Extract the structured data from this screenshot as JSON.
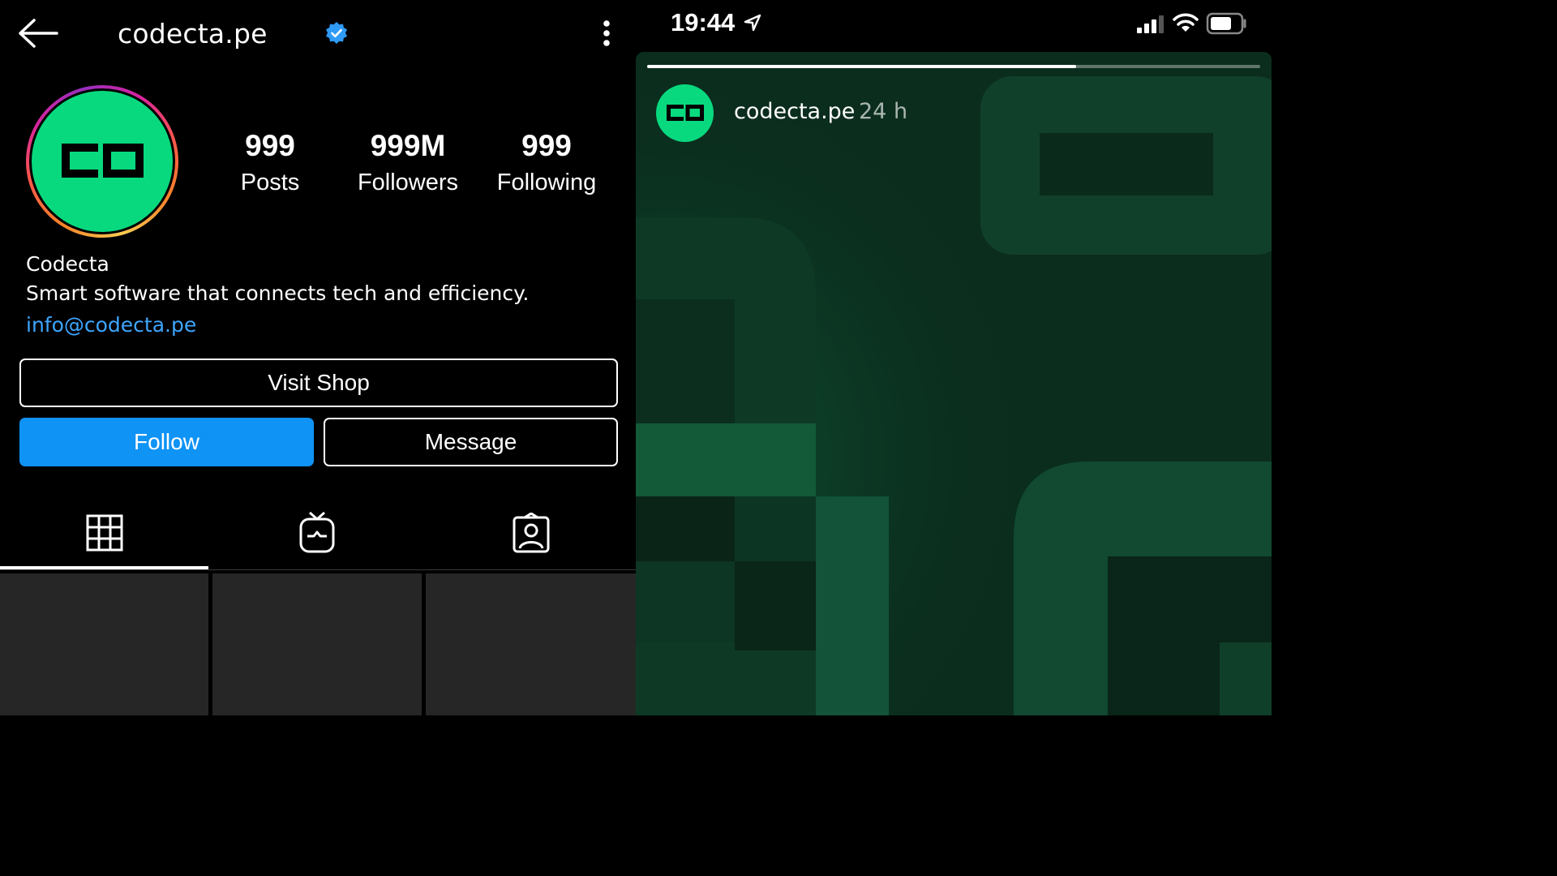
{
  "profile": {
    "header": {
      "username": "codecta.pe"
    },
    "stats": [
      {
        "value": "999",
        "label": "Posts"
      },
      {
        "value": "999M",
        "label": "Followers"
      },
      {
        "value": "999",
        "label": "Following"
      }
    ],
    "bio": {
      "name": "Codecta",
      "text": "Smart software that connects tech and efficiency.",
      "email": "info@codecta.pe"
    },
    "buttons": {
      "shop": "Visit Shop",
      "follow": "Follow",
      "message": "Message"
    },
    "tabs": [
      "posts-grid-icon",
      "igtv-icon",
      "tagged-icon"
    ],
    "colors": {
      "accent": "#0f93f5",
      "link": "#3ea6ff",
      "brand": "#08d97e"
    }
  },
  "story": {
    "status_bar": {
      "time": "19:44"
    },
    "username": "codecta.pe",
    "posted": "24 h",
    "progress": 0.7
  }
}
